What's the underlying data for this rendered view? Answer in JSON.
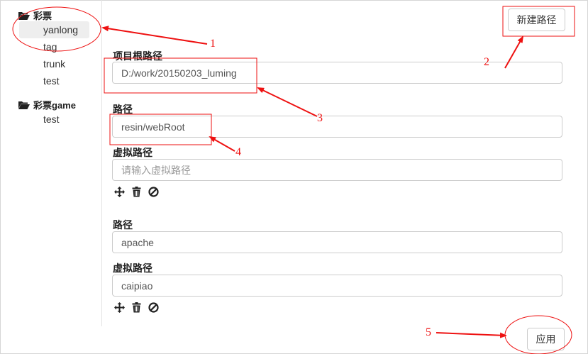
{
  "sidebar": {
    "groups": [
      {
        "label": "彩票",
        "items": [
          "yanlong",
          "tag",
          "trunk",
          "test"
        ],
        "selected": "yanlong"
      },
      {
        "label": "彩票game",
        "items": [
          "test"
        ]
      }
    ]
  },
  "toolbar": {
    "new_path_label": "新建路径"
  },
  "project": {
    "root_label": "项目根路径",
    "root_value": "D:/work/20150203_luming"
  },
  "mappings": [
    {
      "path_label": "路径",
      "path_value": "resin/webRoot",
      "virtual_label": "虚拟路径",
      "virtual_value": "",
      "virtual_placeholder": "请输入虚拟路径"
    },
    {
      "path_label": "路径",
      "path_value": "apache",
      "virtual_label": "虚拟路径",
      "virtual_value": "caipiao",
      "virtual_placeholder": "请输入虚拟路径"
    }
  ],
  "icons": [
    "move-icon",
    "trash-icon",
    "ban-icon"
  ],
  "footer": {
    "apply_label": "应用"
  },
  "annotations": [
    "1",
    "2",
    "3",
    "4",
    "5"
  ],
  "colors": {
    "annotation": "#ee1111",
    "border": "#cccccc",
    "selected_bg": "#eeeeee"
  }
}
